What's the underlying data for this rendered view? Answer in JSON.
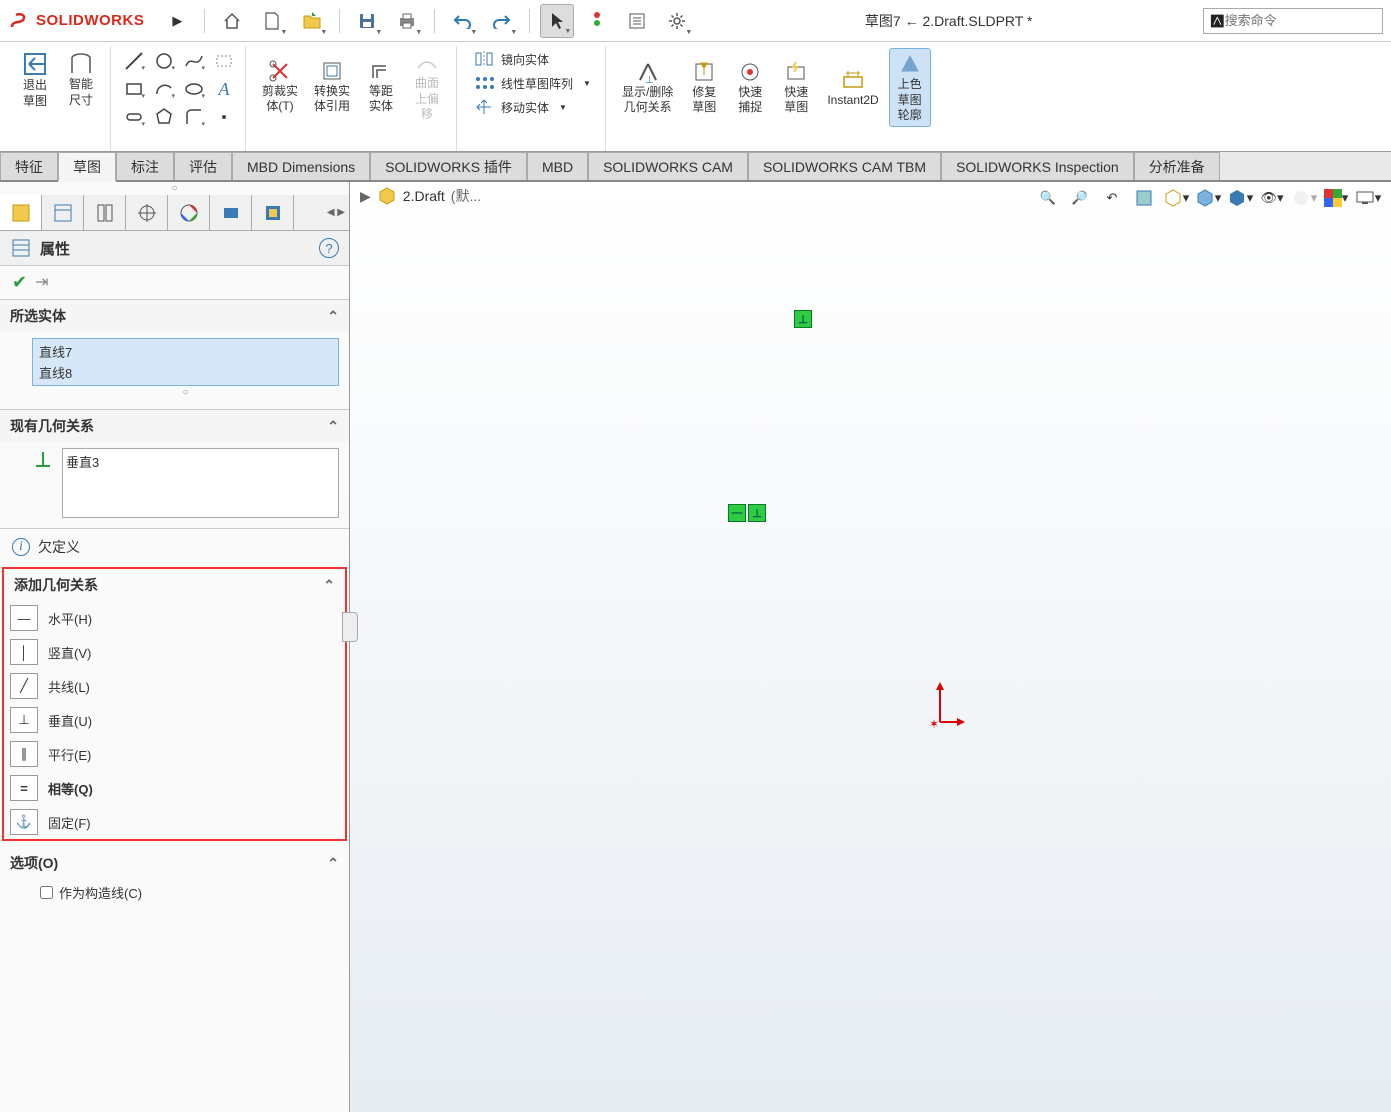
{
  "app": {
    "name": "SOLIDWORKS",
    "doc_title": "草图7 ← 2.Draft.SLDPRT *",
    "search_placeholder": "搜索命令"
  },
  "ribbon": {
    "exit_sketch": "退出\n草图",
    "smart_dim": "智能\n尺寸",
    "trim": "剪裁实\n体(T)",
    "convert": "转换实\n体引用",
    "offset": "等距\n实体",
    "surface_offset": "曲面\n上偏\n移",
    "mirror": "镜向实体",
    "linear_pattern": "线性草图阵列",
    "move": "移动实体",
    "disp_del_rel": "显示/删除\n几何关系",
    "repair_sketch": "修复\n草图",
    "quick_snap": "快速\n捕捉",
    "rapid_sketch": "快速\n草图",
    "instant2d": "Instant2D",
    "shaded_contour": "上色\n草图\n轮廓"
  },
  "tabs": [
    "特征",
    "草图",
    "标注",
    "评估",
    "MBD Dimensions",
    "SOLIDWORKS 插件",
    "MBD",
    "SOLIDWORKS CAM",
    "SOLIDWORKS CAM TBM",
    "SOLIDWORKS Inspection",
    "分析准备"
  ],
  "active_tab": 1,
  "viewport": {
    "model_name": "2.Draft",
    "model_suffix": "(默..."
  },
  "props": {
    "title": "属性",
    "sections": {
      "selected": {
        "title": "所选实体",
        "items": [
          "直线7",
          "直线8"
        ]
      },
      "existing": {
        "title": "现有几何关系",
        "items": [
          "垂直3"
        ]
      },
      "status": "欠定义",
      "add": {
        "title": "添加几何关系",
        "items": [
          {
            "label": "水平(H)",
            "bold": false,
            "glyph": "—"
          },
          {
            "label": "竖直(V)",
            "bold": false,
            "glyph": "│"
          },
          {
            "label": "共线(L)",
            "bold": false,
            "glyph": "╱"
          },
          {
            "label": "垂直(U)",
            "bold": false,
            "glyph": "⊥"
          },
          {
            "label": "平行(E)",
            "bold": false,
            "glyph": "∥"
          },
          {
            "label": "相等(Q)",
            "bold": true,
            "glyph": "="
          },
          {
            "label": "固定(F)",
            "bold": false,
            "glyph": "⚓"
          }
        ]
      },
      "options": {
        "title": "选项(O)",
        "checkbox": "作为构造线(C)"
      }
    }
  }
}
